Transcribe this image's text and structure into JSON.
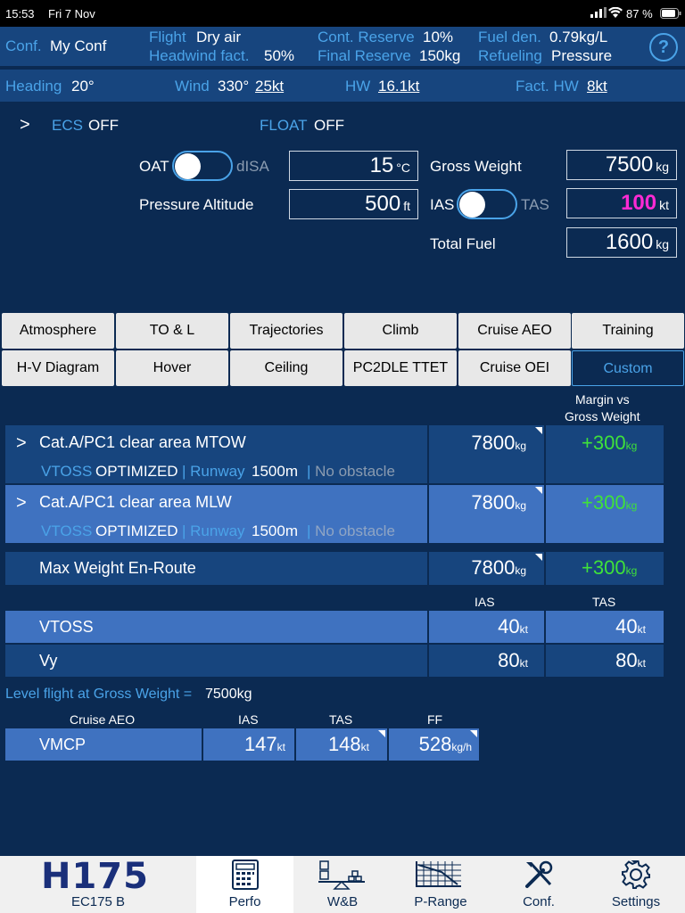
{
  "status": {
    "time": "15:53",
    "date": "Fri 7 Nov",
    "battery": "87 %"
  },
  "header": {
    "conf_label": "Conf.",
    "conf_value": "My Conf",
    "flight_label": "Flight",
    "flight_value": "Dry air",
    "headwind_label": "Headwind fact.",
    "headwind_value": "50%",
    "cont_reserve_label": "Cont. Reserve",
    "cont_reserve_value": "10%",
    "final_reserve_label": "Final Reserve",
    "final_reserve_value": "150kg",
    "fuel_den_label": "Fuel den.",
    "fuel_den_value": "0.79kg/L",
    "refueling_label": "Refueling",
    "refueling_value": "Pressure",
    "help": "?"
  },
  "wind": {
    "heading_label": "Heading",
    "heading_value": "20°",
    "wind_label": "Wind",
    "wind_dir": "330°",
    "wind_speed": "25kt",
    "hw_label": "HW",
    "hw_value": "16.1kt",
    "fact_hw_label": "Fact. HW",
    "fact_hw_value": "8kt"
  },
  "options": {
    "chevron": ">",
    "ecs_label": "ECS",
    "ecs_value": "OFF",
    "float_label": "FLOAT",
    "float_value": "OFF"
  },
  "inputs": {
    "oat_label": "OAT",
    "disa_label": "dISA",
    "oat_value": "15",
    "oat_unit": "°C",
    "pressure_alt_label": "Pressure Altitude",
    "pressure_alt_value": "500",
    "pressure_alt_unit": "ft",
    "gross_weight_label": "Gross Weight",
    "gross_weight_value": "7500",
    "gross_weight_unit": "kg",
    "ias_label": "IAS",
    "tas_label": "TAS",
    "speed_value": "100",
    "speed_unit": "kt",
    "total_fuel_label": "Total Fuel",
    "total_fuel_value": "1600",
    "total_fuel_unit": "kg",
    "speed_color": "#ff2ad4"
  },
  "tabs_row1": [
    "Atmosphere",
    "TO & L",
    "Trajectories",
    "Climb",
    "Cruise AEO",
    "Training"
  ],
  "tabs_row2": [
    "H-V Diagram",
    "Hover",
    "Ceiling",
    "PC2DLE TTET",
    "Cruise OEI",
    "Custom"
  ],
  "margin_header": [
    "Margin vs",
    "Gross Weight"
  ],
  "results": [
    {
      "title": "Cat.A/PC1 clear area MTOW",
      "vtoss_label": "VTOSS",
      "vtoss_value": "OPTIMIZED",
      "runway_label": "Runway",
      "runway_value": "1500m",
      "obstacle": "No obstacle",
      "value": "7800",
      "unit": "kg",
      "margin": "+300",
      "margin_unit": "kg"
    },
    {
      "title": "Cat.A/PC1 clear area MLW",
      "vtoss_label": "VTOSS",
      "vtoss_value": "OPTIMIZED",
      "runway_label": "Runway",
      "runway_value": "1500m",
      "obstacle": "No obstacle",
      "value": "7800",
      "unit": "kg",
      "margin": "+300",
      "margin_unit": "kg"
    },
    {
      "title": "Max Weight En-Route",
      "value": "7800",
      "unit": "kg",
      "margin": "+300",
      "margin_unit": "kg"
    }
  ],
  "speeds": {
    "ias_header": "IAS",
    "tas_header": "TAS",
    "rows": [
      {
        "label": "VTOSS",
        "ias": "40",
        "tas": "40",
        "unit": "kt"
      },
      {
        "label": "Vy",
        "ias": "80",
        "tas": "80",
        "unit": "kt"
      }
    ]
  },
  "level_flight": {
    "label": "Level flight at Gross Weight =",
    "value": "7500kg",
    "col_cruise": "Cruise AEO",
    "col_ias": "IAS",
    "col_tas": "TAS",
    "col_ff": "FF",
    "row_label": "VMCP",
    "ias": "147",
    "ias_unit": "kt",
    "tas": "148",
    "tas_unit": "kt",
    "ff": "528",
    "ff_unit": "kg/h"
  },
  "nav": {
    "logo": "H175",
    "model": "EC175 B",
    "items": [
      "Perfo",
      "W&B",
      "P-Range",
      "Conf.",
      "Settings"
    ]
  }
}
